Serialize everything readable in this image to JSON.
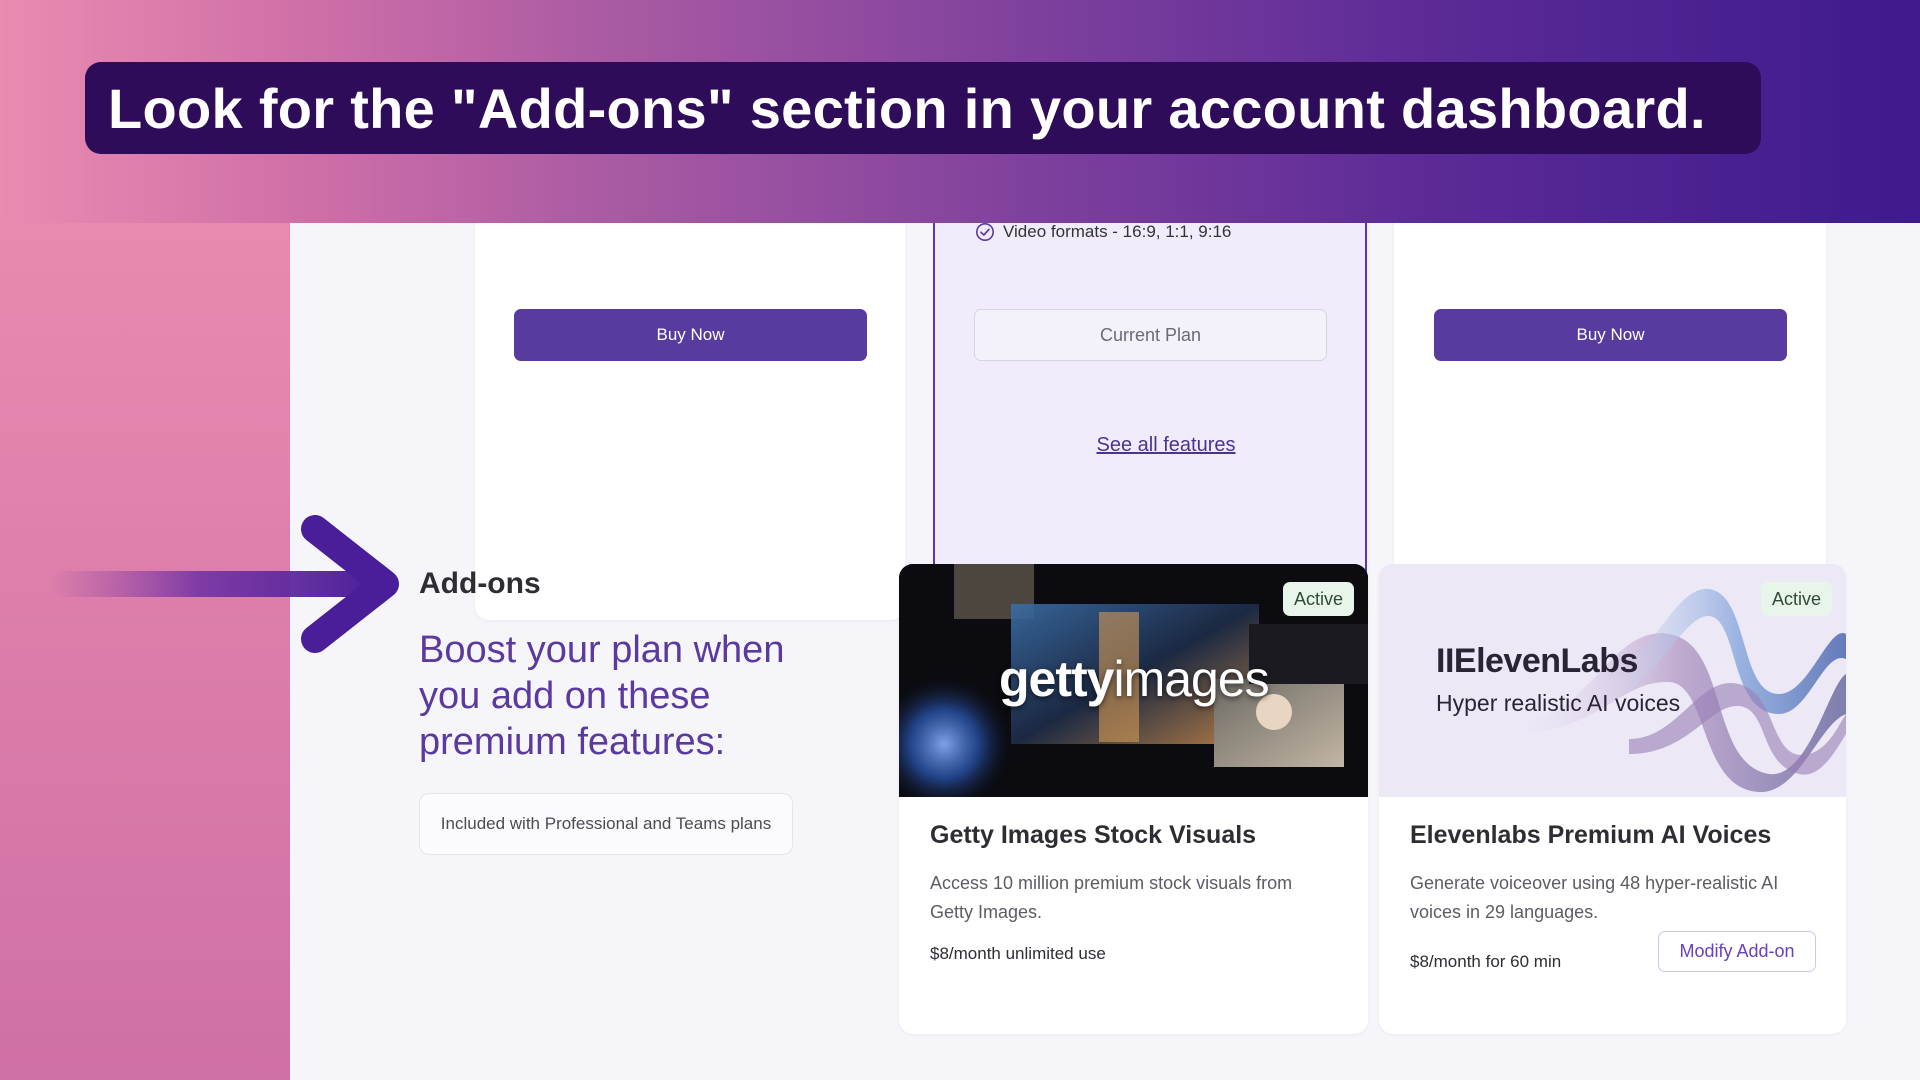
{
  "caption": {
    "text": "Look for the \"Add-ons\" section in your account dashboard."
  },
  "plans": {
    "feature_text": "Video formats - 16:9, 1:1, 9:16",
    "buy_label": "Buy Now",
    "current_label": "Current Plan",
    "see_all": "See all features"
  },
  "addons": {
    "title": "Add-ons",
    "headline": "Boost your plan when you add on these premium features:",
    "included_note": "Included with Professional and Teams plans",
    "cards": [
      {
        "badge": "Active",
        "image_text_bold": "getty",
        "image_text_thin": "images",
        "title": "Getty Images Stock Visuals",
        "description": "Access 10 million premium stock visuals from Getty Images.",
        "price": "$8/month unlimited use"
      },
      {
        "badge": "Active",
        "image_logo": "IIElevenLabs",
        "image_subtitle": "Hyper realistic AI voices",
        "title": "Elevenlabs Premium AI Voices",
        "description": "Generate voiceover using 48 hyper-realistic AI voices in 29 languages.",
        "price": "$8/month for 60 min",
        "action_label": "Modify Add-on"
      }
    ]
  },
  "colors": {
    "accent_purple": "#573b9f",
    "caption_bg": "#2e0c5a",
    "active_badge_bg": "#e8f5ea"
  }
}
